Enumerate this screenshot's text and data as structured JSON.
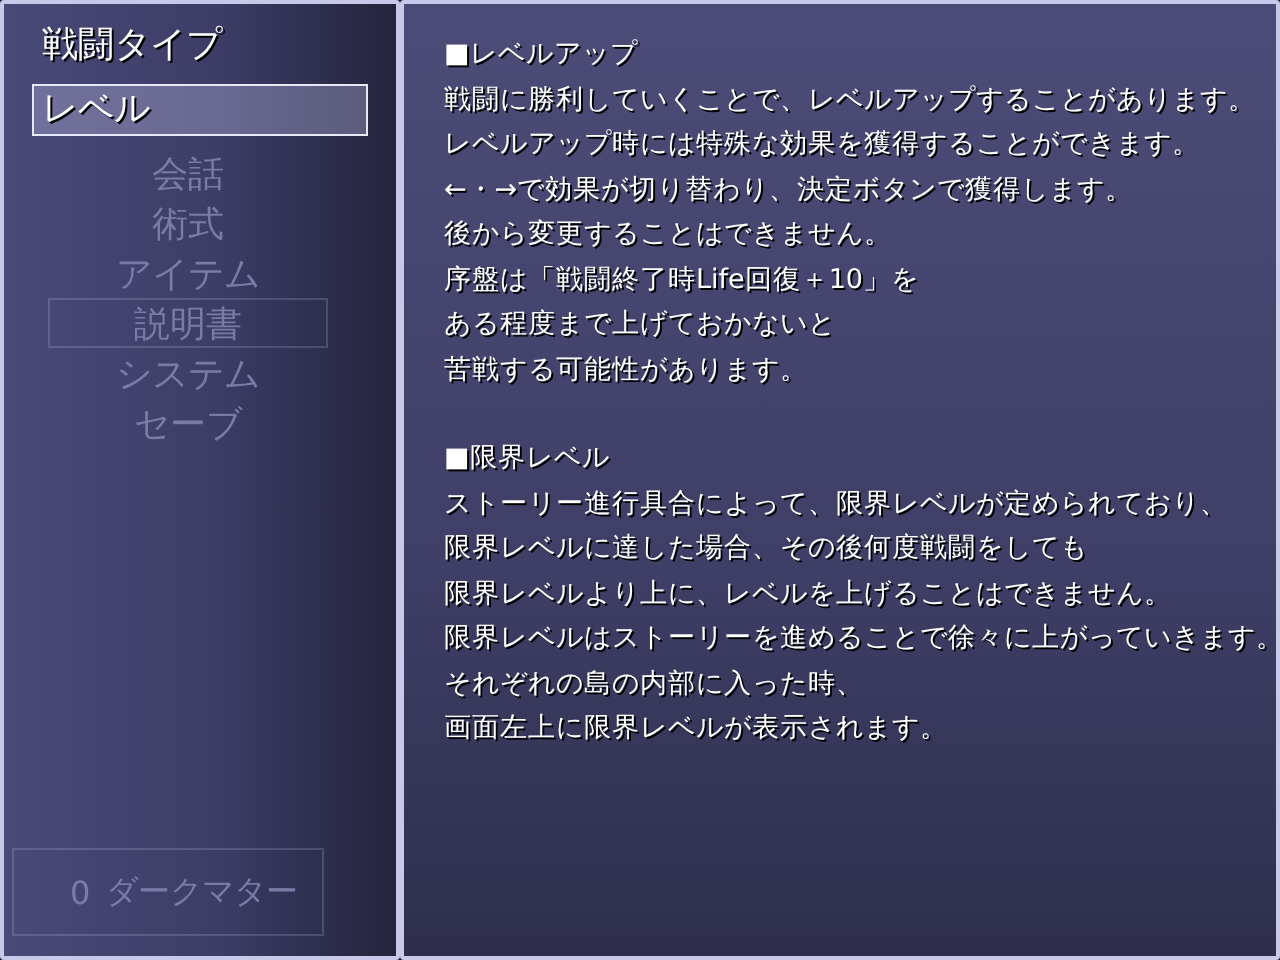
{
  "submenu": {
    "items": [
      {
        "label": "戦闘タイプ",
        "selected": false
      },
      {
        "label": "レベル",
        "selected": true
      }
    ]
  },
  "main_menu": {
    "items": [
      {
        "label": "会話",
        "selected": false
      },
      {
        "label": "術式",
        "selected": false
      },
      {
        "label": "アイテム",
        "selected": false
      },
      {
        "label": "説明書",
        "selected": true
      },
      {
        "label": "システム",
        "selected": false
      },
      {
        "label": "セーブ",
        "selected": false
      }
    ]
  },
  "currency": {
    "amount": "0",
    "name": "ダークマター"
  },
  "help_text": {
    "sections": [
      {
        "heading": "■レベルアップ",
        "lines": [
          "戦闘に勝利していくことで、レベルアップすることがあります。",
          "レベルアップ時には特殊な効果を獲得することができます。",
          "←・→で効果が切り替わり、決定ボタンで獲得します。",
          "後から変更することはできません。",
          "序盤は「戦闘終了時Life回復＋10」を",
          "ある程度まで上げておかないと",
          "苦戦する可能性があります。"
        ]
      },
      {
        "heading": "■限界レベル",
        "lines": [
          "ストーリー進行具合によって、限界レベルが定められており、",
          "限界レベルに達した場合、その後何度戦闘をしても",
          "限界レベルより上に、レベルを上げることはできません。",
          "限界レベルはストーリーを進めることで徐々に上がっていきます。",
          "それぞれの島の内部に入った時、",
          "画面左上に限界レベルが表示されます。"
        ]
      }
    ]
  }
}
